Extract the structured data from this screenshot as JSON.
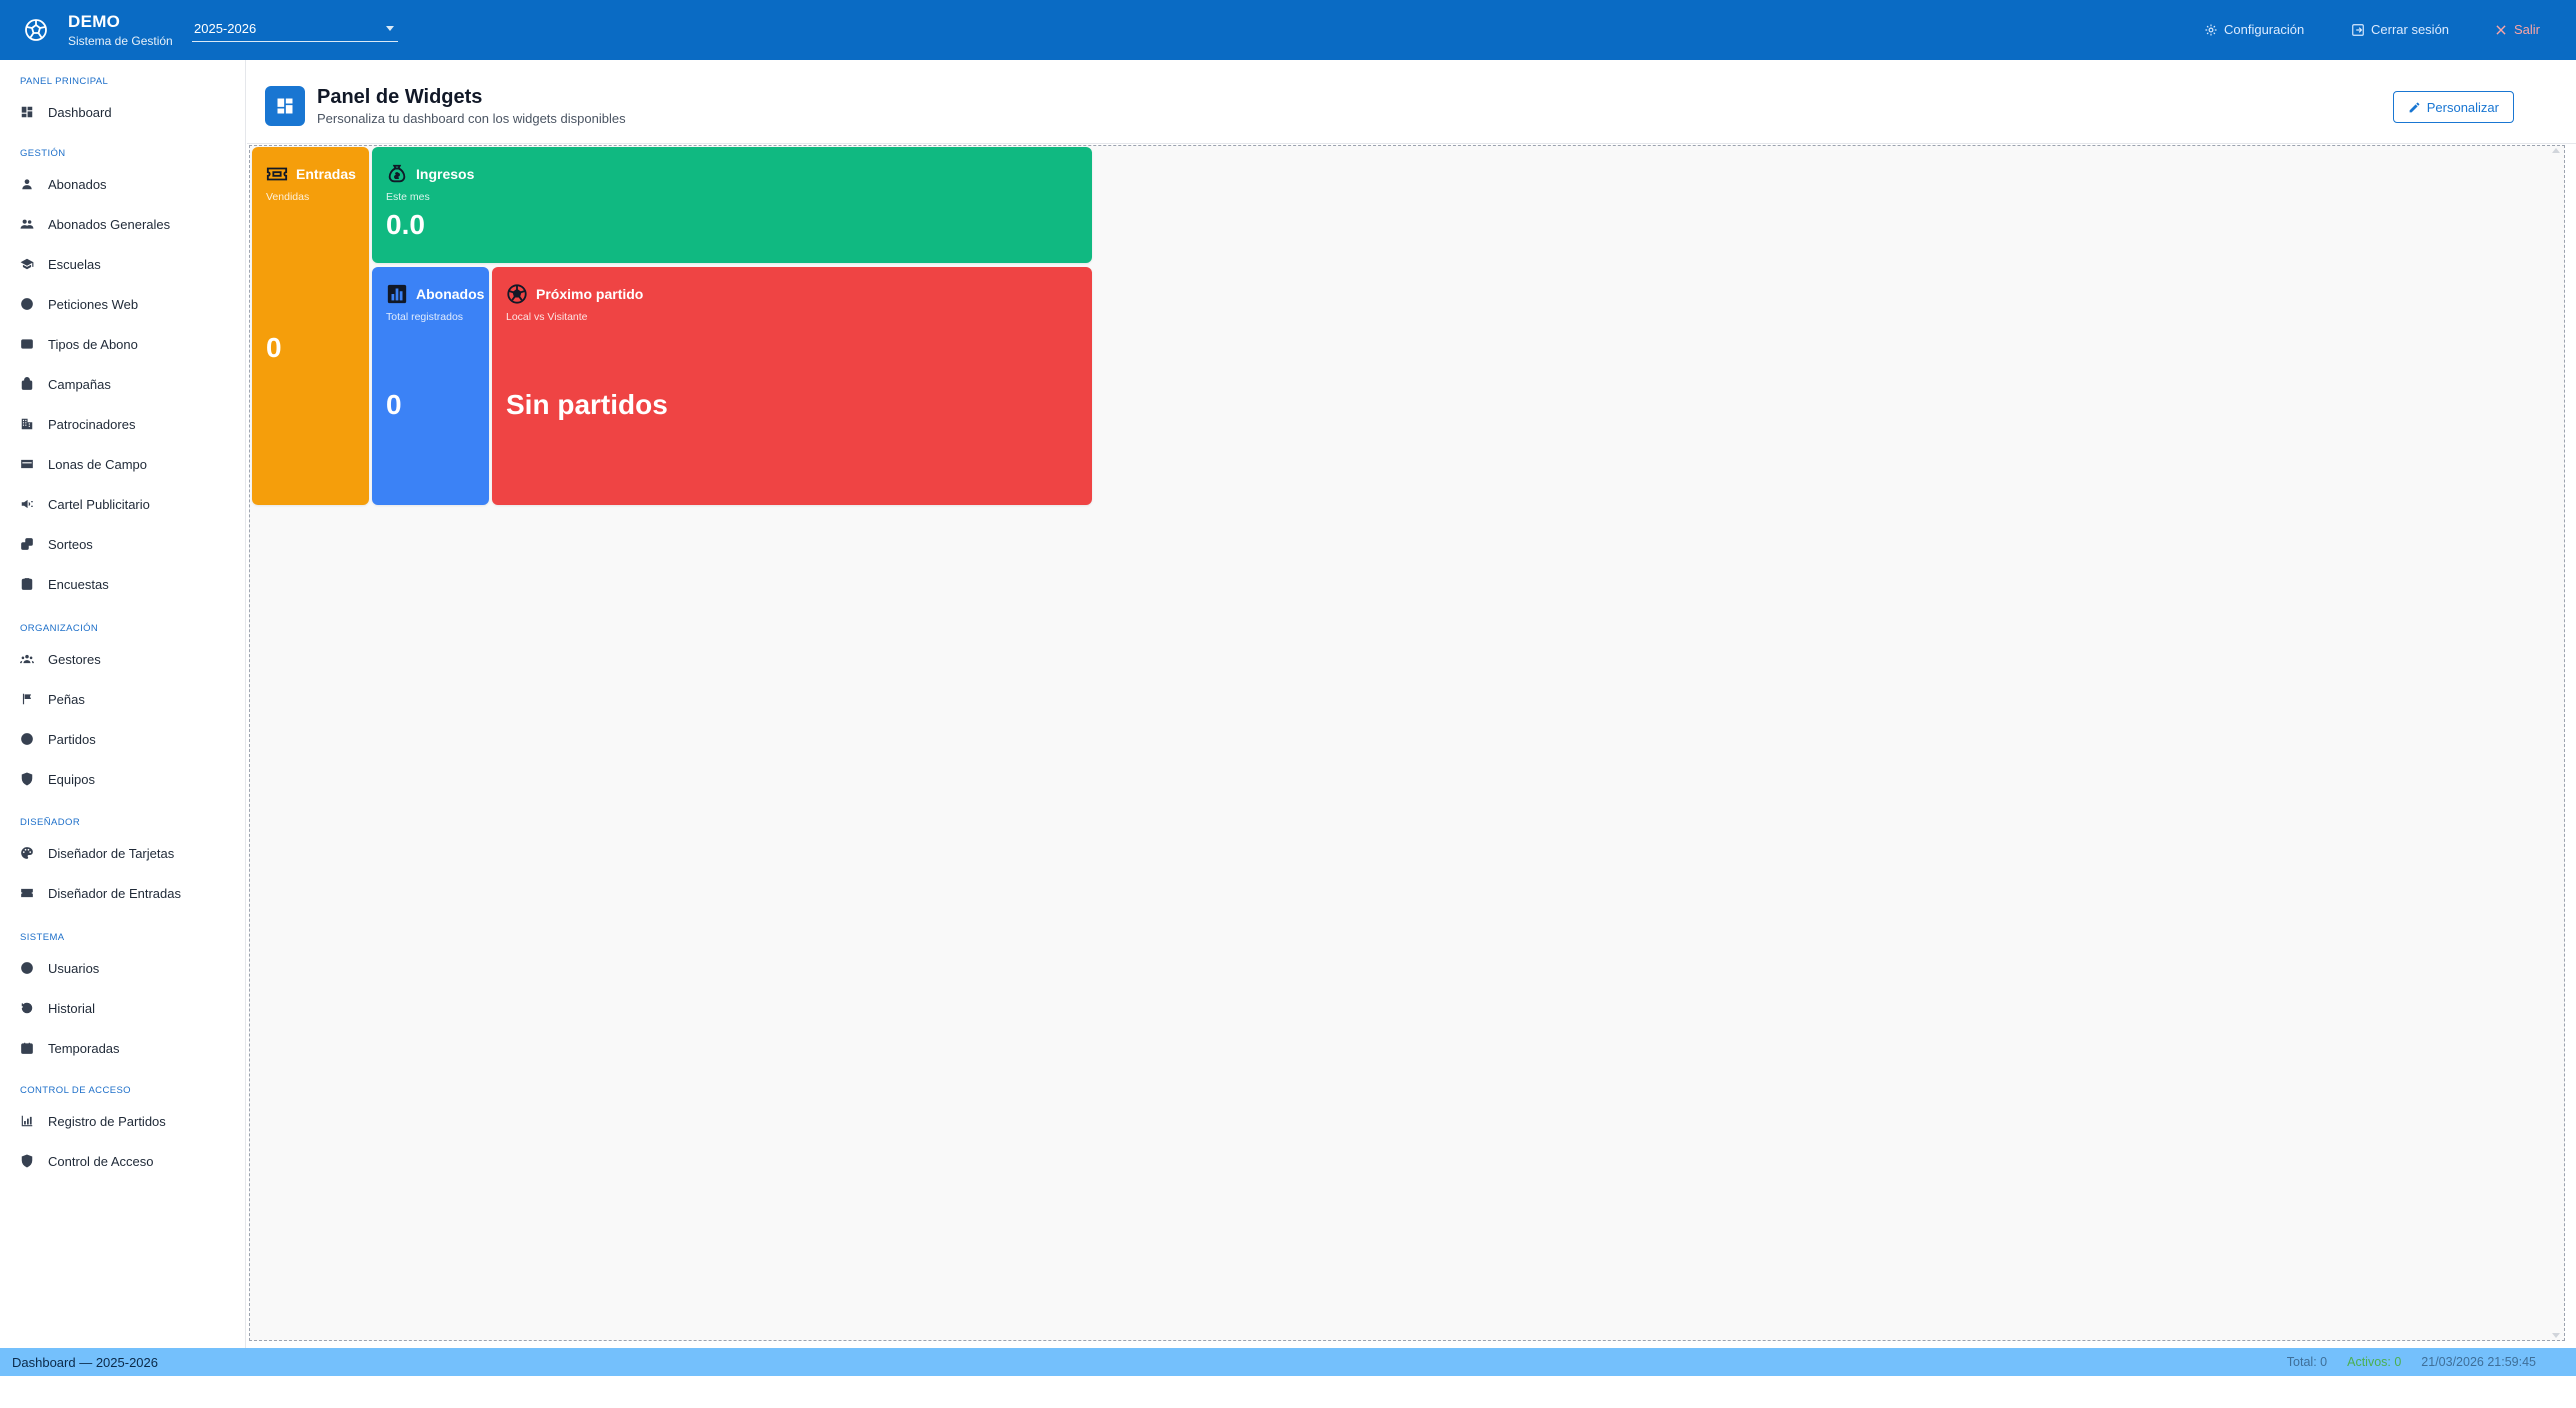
{
  "app": {
    "brand_title": "DEMO",
    "brand_subtitle": "Sistema de Gestión",
    "season": "2025-2026"
  },
  "top_actions": {
    "config": "Configuración",
    "logout": "Cerrar sesión",
    "exit": "Salir"
  },
  "sidebar": {
    "sections": [
      {
        "label": "PANEL PRINCIPAL",
        "items": [
          {
            "label": "Dashboard",
            "icon": "dashboard-icon"
          }
        ]
      },
      {
        "label": "GESTIÓN",
        "items": [
          {
            "label": "Abonados",
            "icon": "person-icon"
          },
          {
            "label": "Abonados Generales",
            "icon": "group-icon"
          },
          {
            "label": "Escuelas",
            "icon": "school-icon"
          },
          {
            "label": "Peticiones Web",
            "icon": "globe-icon"
          },
          {
            "label": "Tipos de Abono",
            "icon": "card-icon"
          },
          {
            "label": "Campañas",
            "icon": "bag-icon"
          },
          {
            "label": "Patrocinadores",
            "icon": "building-icon"
          },
          {
            "label": "Lonas de Campo",
            "icon": "banner-icon"
          },
          {
            "label": "Cartel Publicitario",
            "icon": "megaphone-icon"
          },
          {
            "label": "Sorteos",
            "icon": "dice-icon"
          },
          {
            "label": "Encuestas",
            "icon": "clipboard-icon"
          }
        ]
      },
      {
        "label": "ORGANIZACIÓN",
        "items": [
          {
            "label": "Gestores",
            "icon": "groups-icon"
          },
          {
            "label": "Peñas",
            "icon": "flag-icon"
          },
          {
            "label": "Partidos",
            "icon": "ball-icon"
          },
          {
            "label": "Equipos",
            "icon": "shield-icon"
          }
        ]
      },
      {
        "label": "DISEÑADOR",
        "items": [
          {
            "label": "Diseñador de Tarjetas",
            "icon": "palette-icon"
          },
          {
            "label": "Diseñador de Entradas",
            "icon": "ticket-icon"
          }
        ]
      },
      {
        "label": "SISTEMA",
        "items": [
          {
            "label": "Usuarios",
            "icon": "account-icon"
          },
          {
            "label": "Historial",
            "icon": "history-icon"
          },
          {
            "label": "Temporadas",
            "icon": "calendar-icon"
          }
        ]
      },
      {
        "label": "CONTROL DE ACCESO",
        "items": [
          {
            "label": "Registro de Partidos",
            "icon": "bar-chart-icon"
          },
          {
            "label": "Control de Acceso",
            "icon": "security-icon"
          }
        ]
      }
    ]
  },
  "header": {
    "title": "Panel de Widgets",
    "subtitle": "Personaliza tu dashboard con los widgets disponibles",
    "customize_label": "Personalizar"
  },
  "widgets": {
    "entradas": {
      "title": "Entradas",
      "subtitle": "Vendidas",
      "value": "0",
      "color": "#f59e0b"
    },
    "ingresos": {
      "title": "Ingresos",
      "subtitle": "Este mes",
      "value": "0.0",
      "color": "#10b981"
    },
    "abonados": {
      "title": "Abonados",
      "subtitle": "Total registrados",
      "value": "0",
      "color": "#3b82f6"
    },
    "proximo": {
      "title": "Próximo partido",
      "subtitle": "Local vs Visitante",
      "value": "Sin partidos",
      "color": "#ef4444"
    }
  },
  "statusbar": {
    "left": "Dashboard — 2025-2026",
    "total": "Total: 0",
    "active": "Activos: 0",
    "datetime": "21/03/2026 21:59:45"
  }
}
